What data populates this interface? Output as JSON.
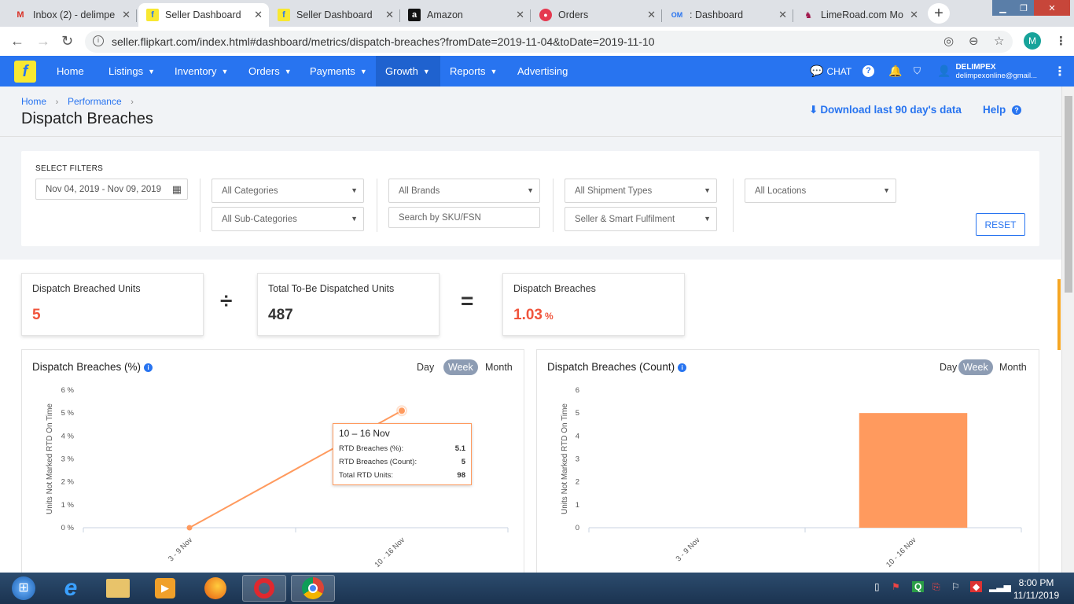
{
  "browser": {
    "tabs": [
      {
        "icon": "gmail-icon",
        "title": "Inbox (2) - delimpe"
      },
      {
        "icon": "flipkart-icon",
        "title": "Seller Dashboard"
      },
      {
        "icon": "flipkart-icon",
        "title": "Seller Dashboard"
      },
      {
        "icon": "amazon-icon",
        "title": "Amazon"
      },
      {
        "icon": "orders-icon",
        "title": "Orders"
      },
      {
        "icon": "om-icon",
        "title": ": Dashboard",
        "badge": "OM"
      },
      {
        "icon": "limeroad-icon",
        "title": "LimeRoad.com Mo"
      }
    ],
    "url": "seller.flipkart.com/index.html#dashboard/metrics/dispatch-breaches?fromDate=2019-11-04&toDate=2019-11-10",
    "avatar_letter": "M"
  },
  "nav": {
    "items": [
      {
        "label": "Home",
        "caret": false
      },
      {
        "label": "Listings",
        "caret": true
      },
      {
        "label": "Inventory",
        "caret": true
      },
      {
        "label": "Orders",
        "caret": true
      },
      {
        "label": "Payments",
        "caret": true
      },
      {
        "label": "Growth",
        "caret": true,
        "active": true
      },
      {
        "label": "Reports",
        "caret": true
      },
      {
        "label": "Advertising",
        "caret": false
      }
    ],
    "chat_label": "CHAT",
    "account_name": "DELIMPEX",
    "account_email": "delimpexonline@gmail..."
  },
  "header": {
    "breadcrumb": [
      "Home",
      "Performance"
    ],
    "title": "Dispatch Breaches",
    "download_label": "Download last 90 day's data",
    "help_label": "Help"
  },
  "filters": {
    "label": "SELECT FILTERS",
    "date_range": "Nov 04, 2019 - Nov 09, 2019",
    "categories": "All Categories",
    "sub_categories": "All Sub-Categories",
    "brands": "All Brands",
    "sku_placeholder": "Search by SKU/FSN",
    "shipment_types": "All Shipment Types",
    "fulfilment": "Seller & Smart Fulfilment",
    "locations": "All Locations",
    "reset_label": "RESET"
  },
  "metrics": {
    "breached": {
      "label": "Dispatch Breached Units",
      "value": "5"
    },
    "divide_symbol": "÷",
    "total": {
      "label": "Total To-Be Dispatched Units",
      "value": "487"
    },
    "equals_symbol": "=",
    "rate": {
      "label": "Dispatch Breaches",
      "value": "1.03",
      "unit": "%"
    }
  },
  "colors": {
    "accent": "#2874f0",
    "series": "#ff9a5e",
    "breach_text": "#f0543c"
  },
  "period_tabs": [
    "Day",
    "Week",
    "Month"
  ],
  "selected_period": "Week",
  "chart_data": [
    {
      "type": "line",
      "title": "Dispatch Breaches (%)",
      "ylabel": "Units Not Marked RTD On Time",
      "categories": [
        "3 - 9 Nov",
        "10 - 16 Nov"
      ],
      "values": [
        0,
        5.1
      ],
      "ylim": [
        0,
        6
      ],
      "yticks": [
        "0 %",
        "1 %",
        "2 %",
        "3 %",
        "4 %",
        "5 %",
        "6 %"
      ],
      "tooltip": {
        "title": "10 – 16 Nov",
        "rows": [
          {
            "label": "RTD Breaches (%):",
            "value": "5.1"
          },
          {
            "label": "RTD Breaches (Count):",
            "value": "5"
          },
          {
            "label": "Total RTD Units:",
            "value": "98"
          }
        ]
      }
    },
    {
      "type": "bar",
      "title": "Dispatch Breaches (Count)",
      "ylabel": "Units Not Marked RTD On Time",
      "categories": [
        "3 - 9 Nov",
        "10 - 16 Nov"
      ],
      "values": [
        0,
        5
      ],
      "ylim": [
        0,
        6
      ],
      "yticks": [
        "0",
        "1",
        "2",
        "3",
        "4",
        "5",
        "6"
      ]
    }
  ],
  "taskbar": {
    "apps": [
      "windows-start",
      "internet-explorer",
      "file-explorer",
      "media-player",
      "firefox",
      "opera",
      "chrome"
    ],
    "time": "8:00 PM",
    "date": "11/11/2019"
  }
}
